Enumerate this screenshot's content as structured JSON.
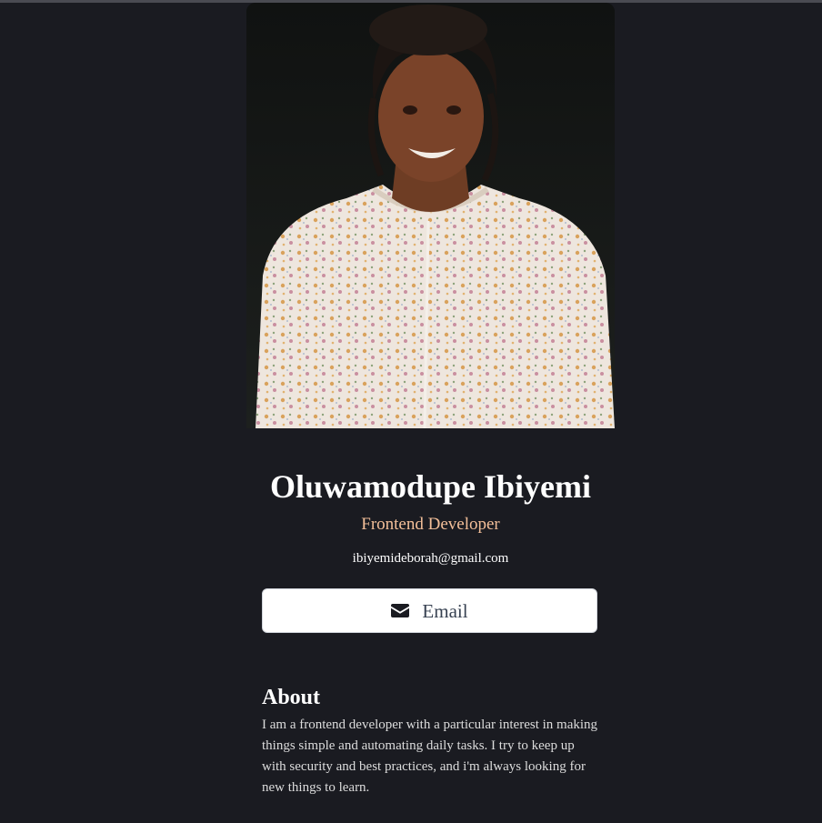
{
  "profile": {
    "photo_alt": "",
    "name": "Oluwamodupe Ibiyemi",
    "role": "Frontend Developer",
    "email": "ibiyemideborah@gmail.com"
  },
  "actions": {
    "email_button_label": "Email",
    "email_icon": "envelope-icon"
  },
  "about": {
    "heading": "About",
    "body": "I am a frontend developer with a particular interest in making things simple and automating daily tasks. I try to keep up with security and best practices, and i'm always looking for new things to learn."
  },
  "colors": {
    "background": "#1a1b21",
    "role_accent": "#f3bf99",
    "button_bg": "#ffffff",
    "button_text": "#374151"
  }
}
